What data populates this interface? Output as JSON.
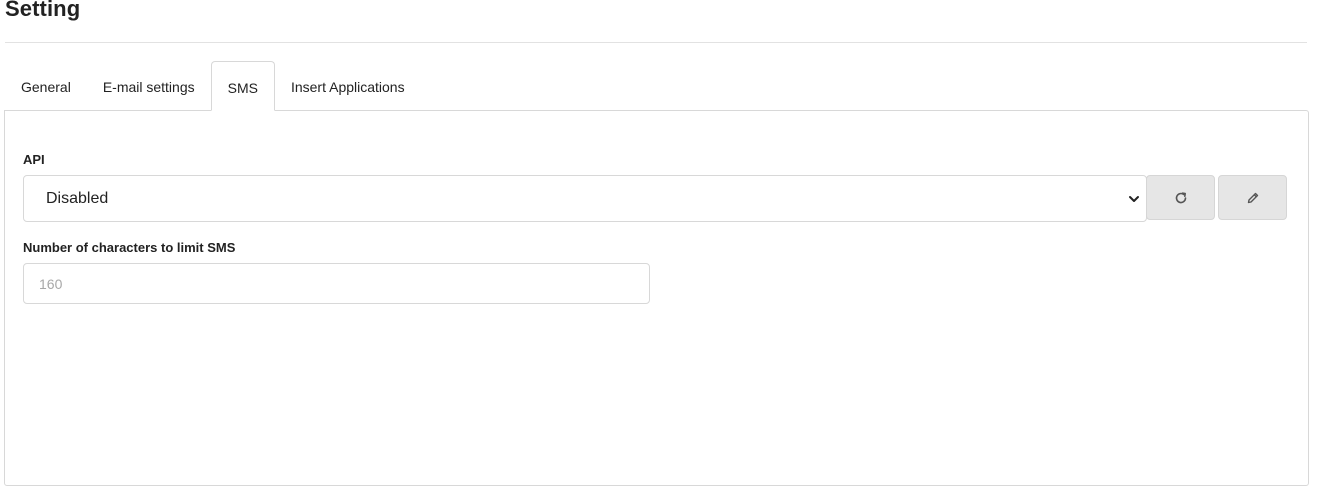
{
  "page": {
    "title": "Setting"
  },
  "tabs": [
    {
      "label": "General",
      "active": false
    },
    {
      "label": "E-mail settings",
      "active": false
    },
    {
      "label": "SMS",
      "active": true
    },
    {
      "label": "Insert Applications",
      "active": false
    }
  ],
  "sms": {
    "api_label": "API",
    "api_selected": "Disabled",
    "refresh_icon": "refresh-icon",
    "edit_icon": "pencil-icon",
    "char_limit_label": "Number of characters to limit SMS",
    "char_limit_value": "",
    "char_limit_placeholder": "160"
  },
  "colors": {
    "button_bg": "#e6e6e6",
    "border": "#d8d8d8",
    "text": "#222222",
    "placeholder": "#a8a8a8"
  }
}
